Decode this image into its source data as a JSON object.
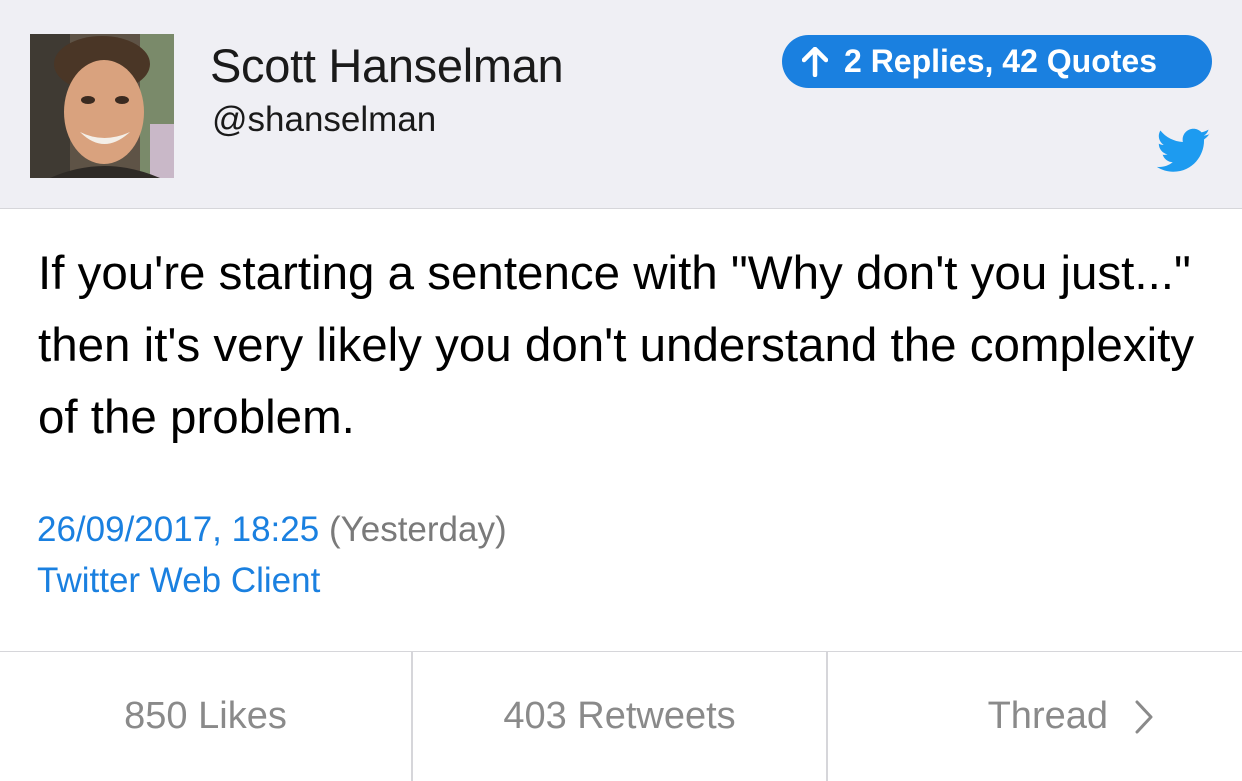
{
  "profile": {
    "name": "Scott Hanselman",
    "handle": "@shanselman"
  },
  "replies_pill": {
    "label": "2 Replies, 42 Quotes",
    "icon": "up-arrow-icon"
  },
  "brand_icon": "twitter-bird-icon",
  "tweet": {
    "text": "If you're starting a sentence with \"Why don't you just...\" then it's very likely you don't understand the complexity of the problem.",
    "timestamp": "26/09/2017, 18:25",
    "relative_time": "(Yesterday)",
    "source": "Twitter Web Client"
  },
  "footer": {
    "likes": "850 Likes",
    "retweets": "403 Retweets",
    "thread": "Thread"
  },
  "colors": {
    "accent": "#1a80e0",
    "header_bg": "#efeff4",
    "muted": "#8a8a8a"
  }
}
